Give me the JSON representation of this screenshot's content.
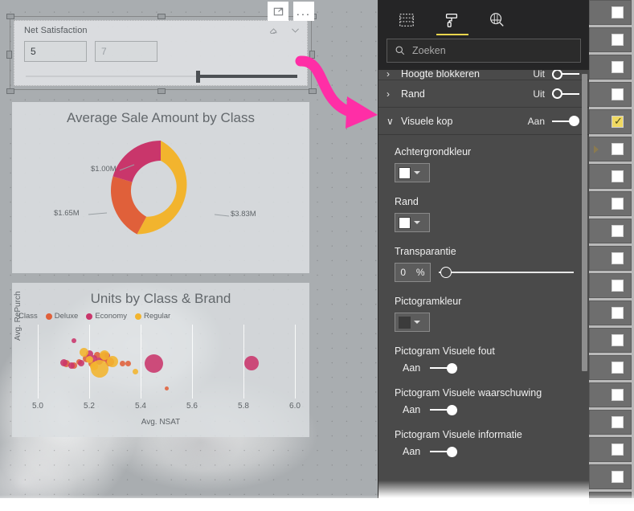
{
  "canvas": {
    "slicer": {
      "title": "Net Satisfaction",
      "min_value": "5",
      "max_value": "7",
      "eraser_icon": "eraser-icon",
      "collapse_icon": "chevron-down-icon"
    },
    "visual_header": {
      "focus_label": "focus-mode-icon",
      "more_label": "..."
    },
    "donut": {
      "title": "Average Sale Amount by Class",
      "labels": [
        "$1.00M",
        "$1.65M",
        "$3.83M"
      ]
    },
    "scatter": {
      "title": "Units by Class & Brand",
      "legend_title": "Class",
      "legend": [
        {
          "label": "Deluxe",
          "color": "#E0603A"
        },
        {
          "label": "Economy",
          "color": "#C9366B"
        },
        {
          "label": "Regular",
          "color": "#F2B42E"
        }
      ],
      "x_label": "Avg. NSAT",
      "y_label": "Avg. RePurch",
      "x_ticks": [
        "5.0",
        "5.2",
        "5.4",
        "5.6",
        "5.8",
        "6.0"
      ]
    }
  },
  "chart_data": [
    {
      "type": "pie",
      "title": "Average Sale Amount by Class",
      "categories": [
        "Regular",
        "Deluxe",
        "Economy"
      ],
      "values": [
        3.83,
        1.65,
        1.0
      ],
      "value_labels": [
        "$3.83M",
        "$1.65M",
        "$1.00M"
      ],
      "colors": [
        "#F2B42E",
        "#E0603A",
        "#C9366B"
      ],
      "unit": "$M",
      "donut": true
    },
    {
      "type": "scatter",
      "title": "Units by Class & Brand",
      "xlabel": "Avg. NSAT",
      "ylabel": "Avg. RePurch",
      "xlim": [
        4.95,
        6.05
      ],
      "xticks": [
        5.0,
        5.2,
        5.4,
        5.6,
        5.8,
        6.0
      ],
      "legend_title": "Class",
      "legend_position": "top-left",
      "grid": false,
      "series": [
        {
          "name": "Deluxe",
          "color": "#E0603A",
          "points": [
            {
              "x": 5.11,
              "y": 0.5,
              "size": 9
            },
            {
              "x": 5.14,
              "y": 0.46,
              "size": 8
            },
            {
              "x": 5.16,
              "y": 0.52,
              "size": 7
            },
            {
              "x": 5.19,
              "y": 0.57,
              "size": 10
            },
            {
              "x": 5.21,
              "y": 0.49,
              "size": 9
            },
            {
              "x": 5.23,
              "y": 0.62,
              "size": 8
            },
            {
              "x": 5.26,
              "y": 0.6,
              "size": 12
            },
            {
              "x": 5.28,
              "y": 0.52,
              "size": 11
            },
            {
              "x": 5.33,
              "y": 0.5,
              "size": 7
            },
            {
              "x": 5.35,
              "y": 0.5,
              "size": 7
            },
            {
              "x": 5.5,
              "y": 0.12,
              "size": 5
            }
          ]
        },
        {
          "name": "Economy",
          "color": "#C9366B",
          "points": [
            {
              "x": 5.1,
              "y": 0.51,
              "size": 9
            },
            {
              "x": 5.13,
              "y": 0.47,
              "size": 8
            },
            {
              "x": 5.14,
              "y": 0.83,
              "size": 6
            },
            {
              "x": 5.17,
              "y": 0.5,
              "size": 8
            },
            {
              "x": 5.2,
              "y": 0.64,
              "size": 9
            },
            {
              "x": 5.22,
              "y": 0.57,
              "size": 8
            },
            {
              "x": 5.24,
              "y": 0.53,
              "size": 9
            },
            {
              "x": 5.27,
              "y": 0.61,
              "size": 7
            },
            {
              "x": 5.45,
              "y": 0.5,
              "size": 23
            },
            {
              "x": 5.83,
              "y": 0.5,
              "size": 18
            }
          ]
        },
        {
          "name": "Regular",
          "color": "#F2B42E",
          "points": [
            {
              "x": 5.18,
              "y": 0.66,
              "size": 11
            },
            {
              "x": 5.2,
              "y": 0.55,
              "size": 9
            },
            {
              "x": 5.22,
              "y": 0.45,
              "size": 10
            },
            {
              "x": 5.24,
              "y": 0.42,
              "size": 22
            },
            {
              "x": 5.26,
              "y": 0.62,
              "size": 12
            },
            {
              "x": 5.29,
              "y": 0.52,
              "size": 14
            },
            {
              "x": 5.38,
              "y": 0.38,
              "size": 7
            }
          ]
        }
      ]
    }
  ],
  "panel": {
    "tabs": [
      {
        "name": "fields-tab",
        "icon": "fields-grid-icon",
        "active": false
      },
      {
        "name": "format-tab",
        "icon": "paint-roller-icon",
        "active": true
      },
      {
        "name": "analytics-tab",
        "icon": "analytics-magnifier-icon",
        "active": false
      }
    ],
    "search_placeholder": "Zoeken",
    "search_icon": "search-icon",
    "rows": [
      {
        "label": "Hoogte blokkeren",
        "state": "Uit",
        "on": false,
        "chevron": "›",
        "cut": true
      },
      {
        "label": "Rand",
        "state": "Uit",
        "on": false,
        "chevron": "›",
        "cut": false
      },
      {
        "label": "Visuele kop",
        "state": "Aan",
        "on": true,
        "chevron": "∨",
        "cut": false
      }
    ],
    "fields": [
      {
        "type": "color",
        "label": "Achtergrondkleur",
        "swatch": "#ffffff"
      },
      {
        "type": "color",
        "label": "Rand",
        "swatch": "#ffffff"
      },
      {
        "type": "slider",
        "label": "Transparantie",
        "value": "0",
        "unit": "%"
      },
      {
        "type": "color",
        "label": "Pictogramkleur",
        "swatch": "#3b3b3b"
      },
      {
        "type": "toggle",
        "label": "Pictogram Visuele fout",
        "state": "Aan",
        "on": true
      },
      {
        "type": "toggle",
        "label": "Pictogram Visuele waarschuwing",
        "state": "Aan",
        "on": true
      },
      {
        "type": "toggle",
        "label": "Pictogram Visuele informatie",
        "state": "Aan",
        "on": true
      }
    ]
  },
  "field_strip": {
    "rows": [
      {
        "checked": false,
        "expander": false
      },
      {
        "checked": false,
        "expander": false
      },
      {
        "checked": false,
        "expander": false
      },
      {
        "checked": false,
        "expander": false
      },
      {
        "checked": true,
        "expander": false
      },
      {
        "checked": false,
        "expander": true
      },
      {
        "checked": false,
        "expander": false
      },
      {
        "checked": false,
        "expander": false
      },
      {
        "checked": false,
        "expander": false
      },
      {
        "checked": false,
        "expander": false
      },
      {
        "checked": false,
        "expander": false
      },
      {
        "checked": false,
        "expander": false
      },
      {
        "checked": false,
        "expander": false
      },
      {
        "checked": false,
        "expander": false
      },
      {
        "checked": false,
        "expander": false
      },
      {
        "checked": false,
        "expander": false
      },
      {
        "checked": false,
        "expander": false
      },
      {
        "checked": false,
        "expander": false
      },
      {
        "checked": false,
        "expander": false
      }
    ]
  },
  "annotation": {
    "arrow_color": "#FF2EA6",
    "name": "pink-pointer-arrow"
  }
}
